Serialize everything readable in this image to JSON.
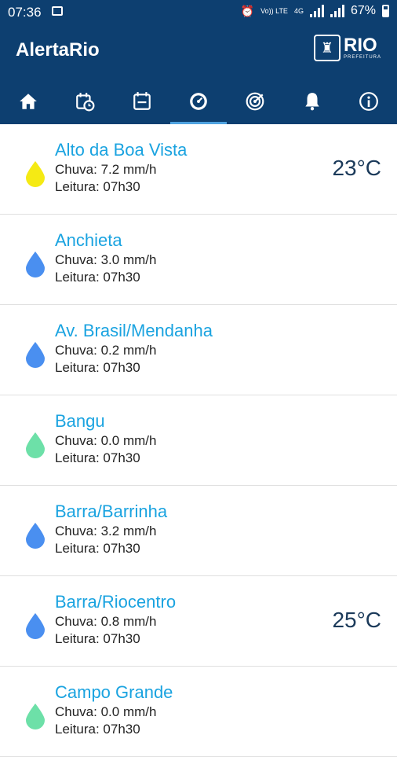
{
  "status_bar": {
    "time": "07:36",
    "battery": "67%",
    "net_label": "4G",
    "carrier": "Vo)) LTE"
  },
  "app": {
    "title": "AlertaRio",
    "logo_text": "RIO",
    "logo_sub": "PREFEITURA"
  },
  "tabs": [
    {
      "icon": "home-icon",
      "active": false
    },
    {
      "icon": "calendar-clock-icon",
      "active": false
    },
    {
      "icon": "calendar-icon",
      "active": false
    },
    {
      "icon": "gauge-icon",
      "active": true
    },
    {
      "icon": "radar-icon",
      "active": false
    },
    {
      "icon": "bell-icon",
      "active": false
    },
    {
      "icon": "info-icon",
      "active": false
    }
  ],
  "colors": {
    "header": "#0d3f70",
    "accent": "#1aa3e0",
    "drop_yellow": "#f5ea14",
    "drop_blue": "#4a8ff0",
    "drop_green": "#6de0a8"
  },
  "stations": [
    {
      "name": "Alto da Boa Vista",
      "rain": "Chuva: 7.2 mm/h",
      "reading": "Leitura: 07h30",
      "temp": "23°C",
      "drop_color": "#f5ea14"
    },
    {
      "name": "Anchieta",
      "rain": "Chuva: 3.0 mm/h",
      "reading": "Leitura: 07h30",
      "temp": "",
      "drop_color": "#4a8ff0"
    },
    {
      "name": "Av. Brasil/Mendanha",
      "rain": "Chuva: 0.2 mm/h",
      "reading": "Leitura: 07h30",
      "temp": "",
      "drop_color": "#4a8ff0"
    },
    {
      "name": "Bangu",
      "rain": "Chuva: 0.0 mm/h",
      "reading": "Leitura: 07h30",
      "temp": "",
      "drop_color": "#6de0a8"
    },
    {
      "name": "Barra/Barrinha",
      "rain": "Chuva: 3.2 mm/h",
      "reading": "Leitura: 07h30",
      "temp": "",
      "drop_color": "#4a8ff0"
    },
    {
      "name": "Barra/Riocentro",
      "rain": "Chuva: 0.8 mm/h",
      "reading": "Leitura: 07h30",
      "temp": "25°C",
      "drop_color": "#4a8ff0"
    },
    {
      "name": "Campo Grande",
      "rain": "Chuva: 0.0 mm/h",
      "reading": "Leitura: 07h30",
      "temp": "",
      "drop_color": "#6de0a8"
    }
  ]
}
